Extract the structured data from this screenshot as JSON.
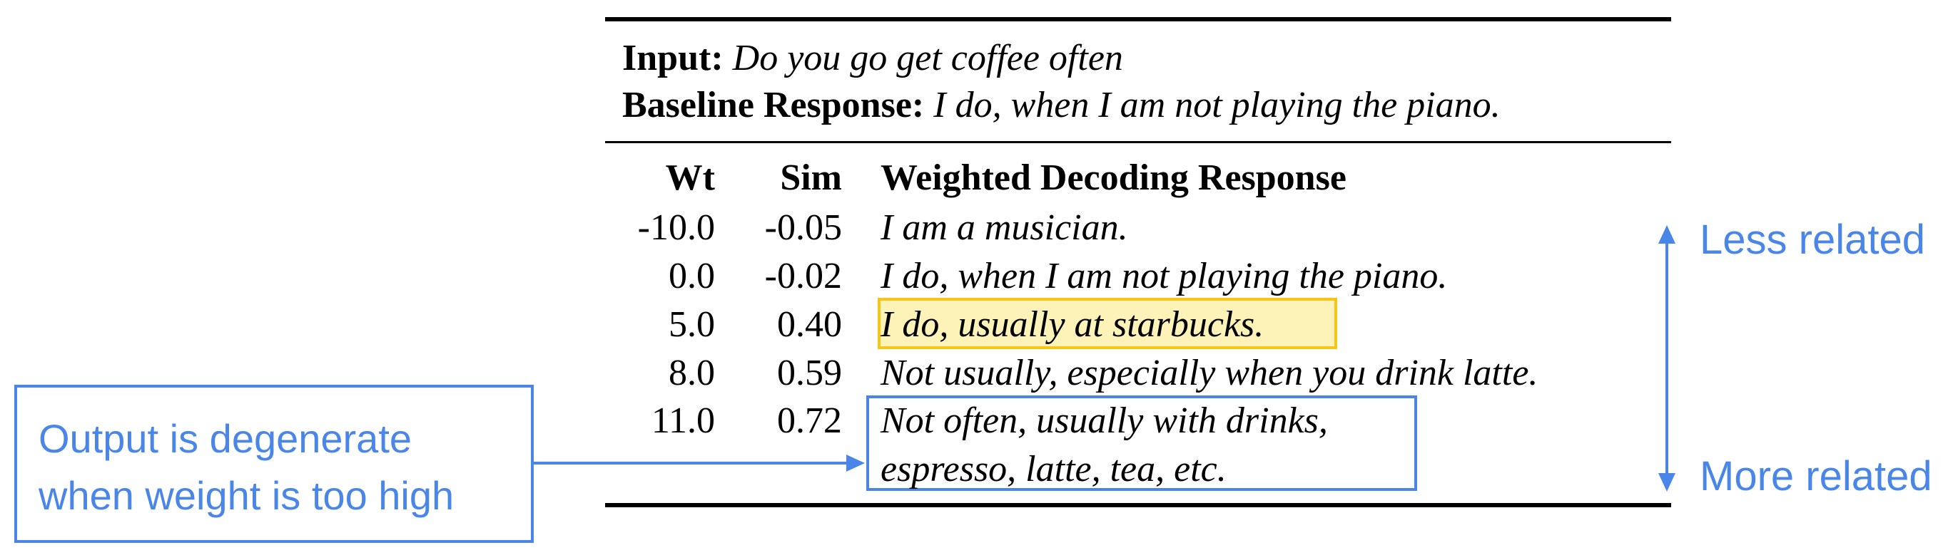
{
  "header": {
    "input_label": "Input:",
    "input_text": "Do you go get coffee often",
    "baseline_label": "Baseline Response:",
    "baseline_text": "I do, when I am not playing the piano."
  },
  "table": {
    "columns": [
      "Wt",
      "Sim",
      "Weighted Decoding Response"
    ],
    "rows": [
      {
        "wt": "-10.0",
        "sim": "-0.05",
        "response": "I am a musician."
      },
      {
        "wt": "0.0",
        "sim": "-0.02",
        "response": "I do, when I am not playing the piano."
      },
      {
        "wt": "5.0",
        "sim": "0.40",
        "response": "I do, usually at starbucks."
      },
      {
        "wt": "8.0",
        "sim": "0.59",
        "response": "Not usually, especially when you drink latte."
      },
      {
        "wt": "11.0",
        "sim": "0.72",
        "response_line1": "Not often, usually with drinks,",
        "response_line2": "espresso, latte, tea, etc."
      }
    ]
  },
  "annotations": {
    "callout_line1": "Output is degenerate",
    "callout_line2": "when weight is too high",
    "less_related": "Less related",
    "more_related": "More related"
  },
  "colors": {
    "accent_blue": "#4a86e8",
    "highlight_fill": "#fdf3b8",
    "highlight_border": "#f5c518"
  }
}
